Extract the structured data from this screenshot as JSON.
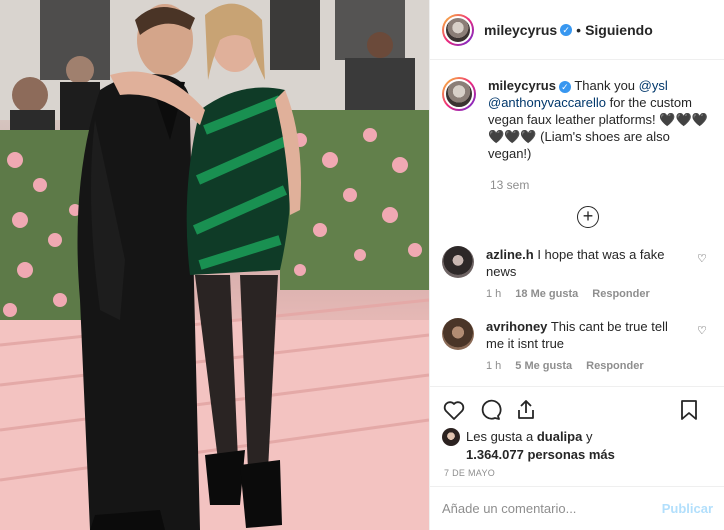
{
  "header": {
    "username": "mileycyrus",
    "separator": "•",
    "follow_label": "Siguiendo"
  },
  "caption": {
    "username": "mileycyrus",
    "text_before": "Thank you ",
    "mention1": "@ysl",
    "mention2": "@anthonyvaccarello",
    "text_after": " for the custom vegan faux leather platforms! 🖤🖤🖤🖤🖤🖤 (Liam's shoes are also vegan!)",
    "time": "13 sem"
  },
  "comments": [
    {
      "username": "azline.h",
      "text": "I hope that was a fake news",
      "time": "1 h",
      "likes": "18 Me gusta",
      "reply": "Responder"
    },
    {
      "username": "avrihoney",
      "text": "This cant be true tell me it isnt true",
      "time": "1 h",
      "likes": "5 Me gusta",
      "reply": "Responder"
    }
  ],
  "likes": {
    "prefix": "Les gusta a ",
    "user": "dualipa",
    "middle": " y",
    "count": "1.364.077 personas más"
  },
  "date": "7 DE MAYO",
  "add_comment": {
    "placeholder": "Añade un comentario...",
    "publish_label": "Publicar"
  },
  "icons": {
    "like": "heart-icon",
    "comment": "comment-icon",
    "share": "share-icon",
    "save": "bookmark-icon",
    "load_more": "plus-circle-icon",
    "verified": "verified-badge-icon"
  },
  "colors": {
    "link": "#00376b",
    "verified": "#3897f0",
    "muted": "#8e8e8e",
    "publish_disabled": "#b2dffc"
  }
}
